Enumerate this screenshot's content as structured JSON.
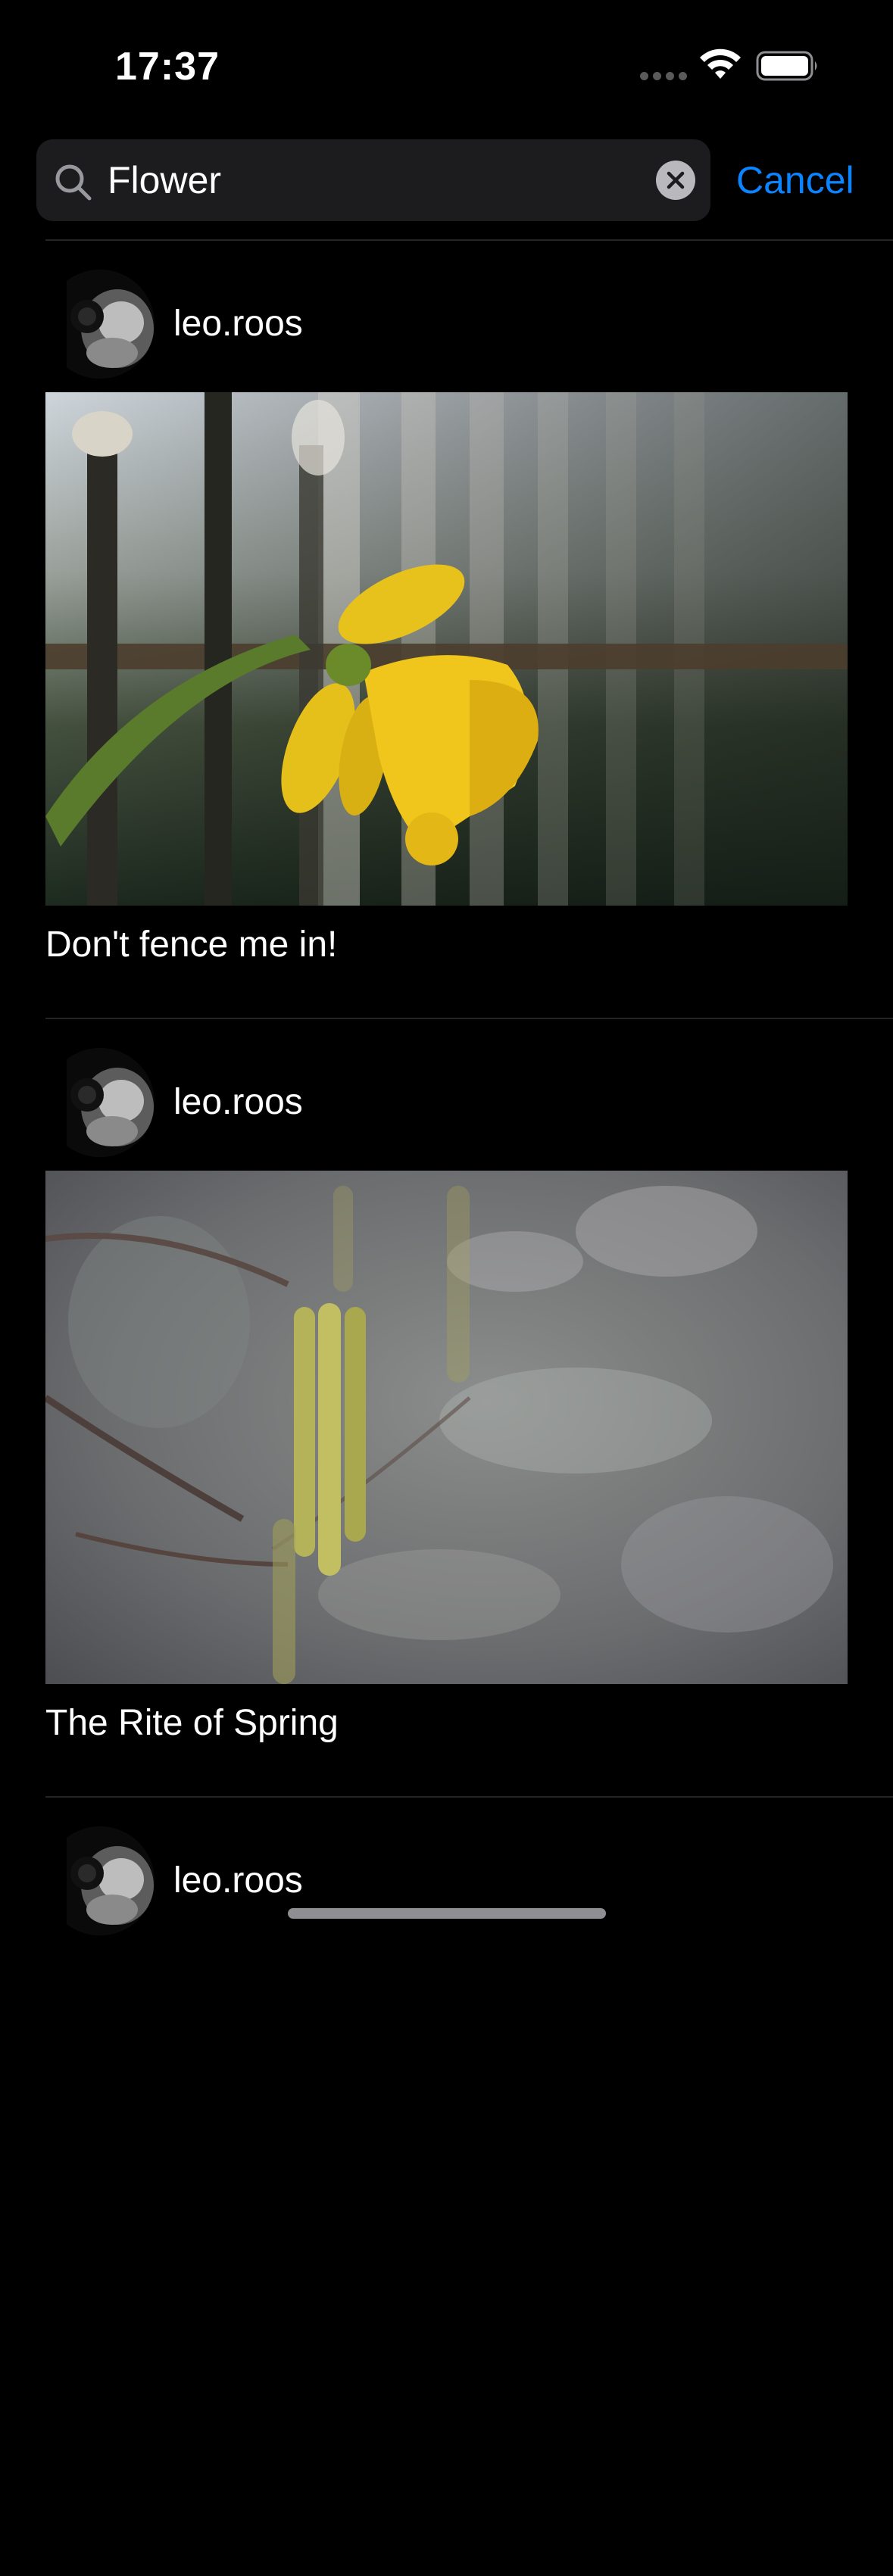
{
  "status_bar": {
    "time": "17:37",
    "wifi_icon": "wifi-icon",
    "battery_icon": "battery-icon"
  },
  "search": {
    "value": "Flower",
    "icon": "search-icon",
    "clear_icon": "clear-icon",
    "cancel_label": "Cancel"
  },
  "colors": {
    "accent": "#0a84ff",
    "background": "#000000",
    "field": "#1c1c1e"
  },
  "posts": [
    {
      "username": "leo.roos",
      "caption": "Don't fence me in!"
    },
    {
      "username": "leo.roos",
      "caption": "The Rite of Spring"
    },
    {
      "username": "leo.roos",
      "caption": ""
    }
  ]
}
